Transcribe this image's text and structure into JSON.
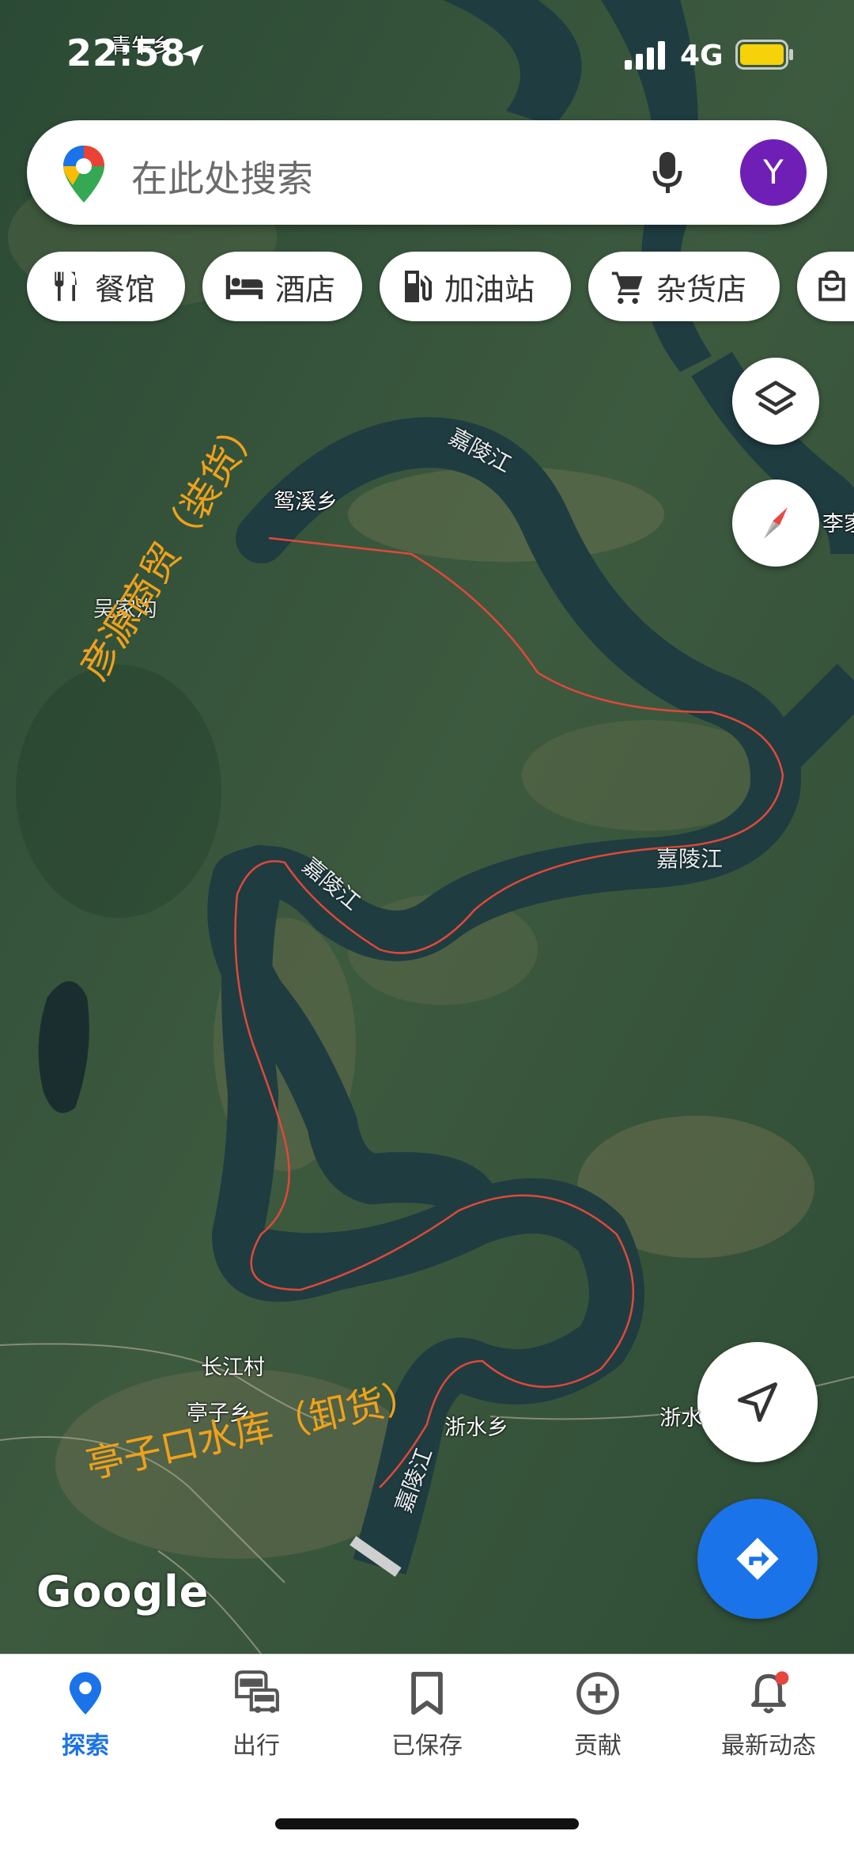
{
  "status_bar": {
    "time": "22:58",
    "network": "4G",
    "location_label": "青牛乡"
  },
  "search": {
    "placeholder": "在此处搜索",
    "avatar_letter": "Y"
  },
  "chips": [
    {
      "icon": "restaurant-icon",
      "label": "餐馆"
    },
    {
      "icon": "hotel-icon",
      "label": "酒店"
    },
    {
      "icon": "gas-station-icon",
      "label": "加油站"
    },
    {
      "icon": "shopping-cart-icon",
      "label": "杂货店"
    },
    {
      "icon": "shopping-bag-icon",
      "label": ""
    }
  ],
  "map_labels": {
    "yuanxi": "鸳溪乡",
    "wujia": "吴家沟",
    "lijia": "李家",
    "changjiang_village": "长江村",
    "tingzi": "亭子乡",
    "zheshui": "浙水乡",
    "zheshui2": "浙水"
  },
  "river_labels": [
    "嘉陵江",
    "嘉陵江",
    "嘉陵江",
    "嘉陵江"
  ],
  "annotations": {
    "load": "彦源商贸（装货）",
    "unload": "亭子口水库（卸货）"
  },
  "google_logo": "Google",
  "bottom_nav": [
    {
      "icon": "explore-pin-icon",
      "label": "探索",
      "active": true
    },
    {
      "icon": "commute-icon",
      "label": "出行",
      "active": false
    },
    {
      "icon": "bookmark-icon",
      "label": "已保存",
      "active": false
    },
    {
      "icon": "add-circle-icon",
      "label": "贡献",
      "active": false
    },
    {
      "icon": "notification-bell-icon",
      "label": "最新动态",
      "active": false
    }
  ],
  "colors": {
    "accent": "#1a73e8",
    "annotation": "#f0a11a",
    "route": "#e0483a",
    "avatar": "#6f1fb5"
  }
}
